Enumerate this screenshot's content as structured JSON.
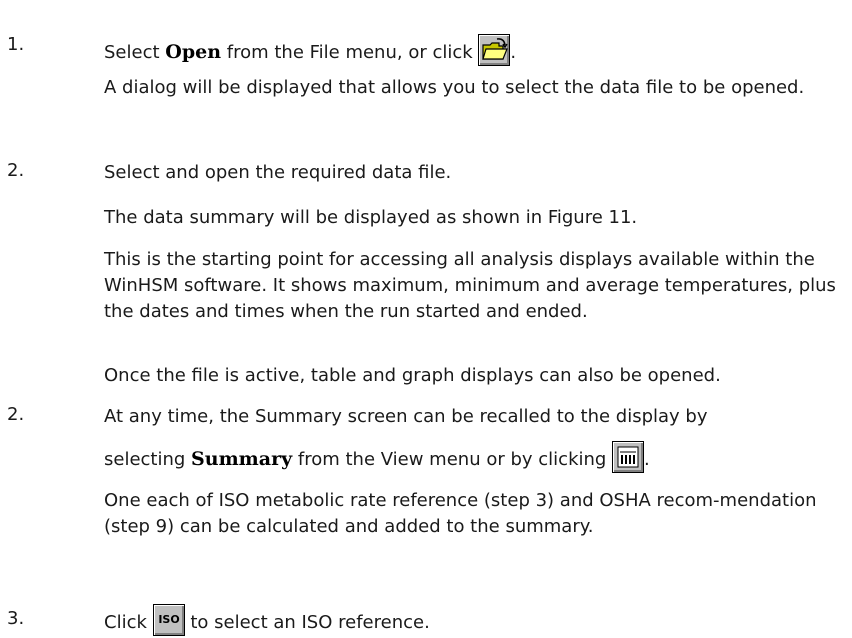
{
  "steps": [
    {
      "num": "1.",
      "pre": "Select ",
      "bold": "Open",
      "post": " from the File menu, or click ",
      "tail": "."
    },
    {
      "text": "A dialog will be displayed that allows you to select the data file to be opened."
    },
    {
      "num": "2.",
      "text": "Select and open the required data file."
    },
    {
      "text": "The data summary will be displayed as shown in Figure 11."
    },
    {
      "text": "This is the starting point for accessing all analysis displays available within the WinHSM software. It shows maximum, minimum and average temperatures, plus the dates and times when the run started and ended."
    },
    {
      "text": "Once the file is active, table and graph displays can also be opened."
    },
    {
      "num": "2.",
      "line1": "At any time, the Summary screen can be recalled to the display by",
      "pre": "selecting ",
      "bold": "Summary",
      "post": " from the View menu or by clicking ",
      "tail": "."
    },
    {
      "text": "One each of ISO metabolic rate reference (step 3) and OSHA recom-mendation (step 9) can be calculated and added to the summary."
    },
    {
      "num": "3.",
      "pre": "Click ",
      "post": " to select an ISO reference.",
      "icon_label": "ISO"
    }
  ]
}
